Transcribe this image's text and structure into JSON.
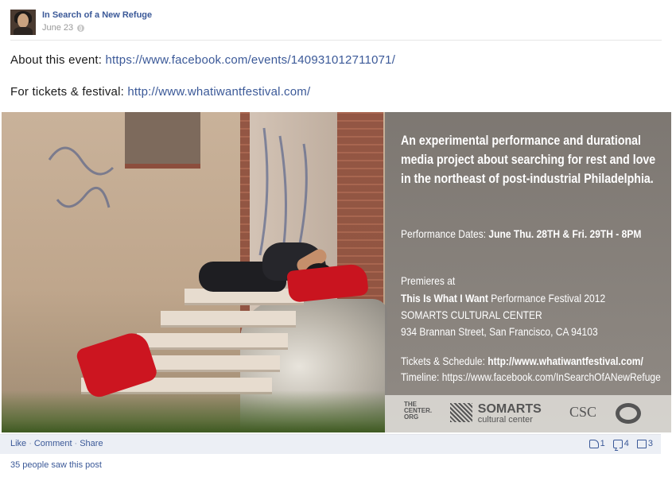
{
  "post": {
    "author": "In Search of a New Refuge",
    "date": "June 23",
    "privacy_icon": "globe-icon",
    "line1_text": "About this event: ",
    "line1_link": "https://www.facebook.com/events/140931012711071/",
    "line2_text": "For tickets & festival: ",
    "line2_link": "http://www.whatiwantfestival.com/"
  },
  "image": {
    "headline": "An experimental performance and durational media project about searching for rest and love in the northeast of post-industrial Philadelphia.",
    "dates_label": "Performance Dates: ",
    "dates_value": "June Thu. 28TH & Fri. 29TH - 8PM",
    "premieres": "Premieres at",
    "festival_name": "This Is What I Want",
    "festival_rest": " Performance Festival 2012",
    "venue": "SOMARTS CULTURAL CENTER",
    "address": "934 Brannan Street, San Francisco, CA 94103",
    "tickets_label": "Tickets & Schedule: ",
    "tickets_url": "http://www.whatiwantfestival.com/",
    "timeline": "Timeline: https://www.facebook.com/InSearchOfANewRefuge",
    "logo_center": "THE\nCENTER.\nORG",
    "logo_somarts": "SOMARTS",
    "logo_somarts_sub": "cultural center",
    "logo_csc": "CSC"
  },
  "actions": {
    "like": "Like",
    "comment": "Comment",
    "share": "Share",
    "sep": "·",
    "likes_count": "1",
    "comments_count": "4",
    "shares_count": "3"
  },
  "seen": "35 people saw this post"
}
